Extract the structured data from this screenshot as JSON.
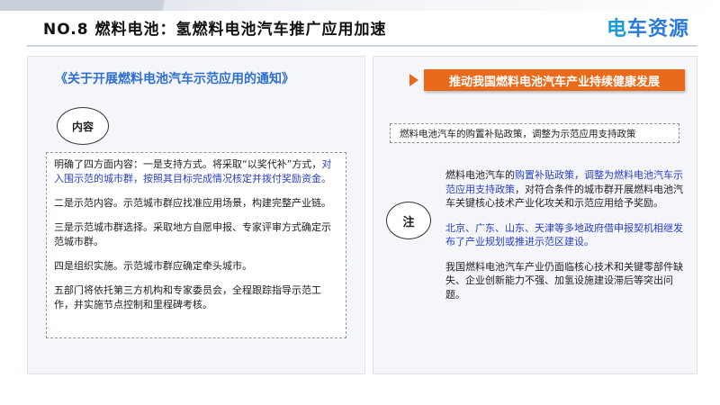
{
  "header": {
    "title": "NO.8  燃料电池：氢燃料电池汽车推广应用加速",
    "logo_mark": "电",
    "logo_text": "车资源"
  },
  "left_panel": {
    "notice_title": "《关于开展燃料电池汽车示范应用的通知》",
    "content_label": "内容",
    "p1_plain": "明确了四方面内容：一是支持方式。将采取“以奖代补”方式，",
    "p1_blue": "对入围示范的城市群，按照其目标完成情况核定并拨付奖励资金。",
    "p2": "二是示范内容。示范城市群应找准应用场景，构建完整产业链。",
    "p3": "三是示范城市群选择。采取地方自愿申报、专家评审方式确定示范城市群。",
    "p4": "四是组织实施。示范城市群应确定牵头城市。",
    "p5": "五部门将依托第三方机构和专家委员会，全程跟踪指导示范工作，并实施节点控制和里程碑考核。"
  },
  "right_panel": {
    "banner": "推动我国燃料电池汽车产业持续健康发展",
    "subsidy_summary": "燃料电池汽车的购置补贴政策，调整为示范应用支持政策",
    "note_label": "注",
    "n1_a": "燃料电池汽车的",
    "n1_b": "购置补贴政策，调整为燃料电池汽车示范应用支持政策",
    "n1_c": "，对符合条件的城市群开展燃料电池汽车关键核心技术产业化攻关和示范应用给予奖励。",
    "n2": "北京、广东、山东、天津等多地政府借申报契机相继发布了产业规划或推进示范区建设。",
    "n3": "我国燃料电池汽车产业仍面临核心技术和关键零部件缺失、企业创新能力不强、加氢设施建设滞后等突出问题。"
  },
  "colors": {
    "accent_orange": "#ea6a1c",
    "title_blue": "#2f6fd0",
    "highlight_blue": "#2a3fc4"
  }
}
